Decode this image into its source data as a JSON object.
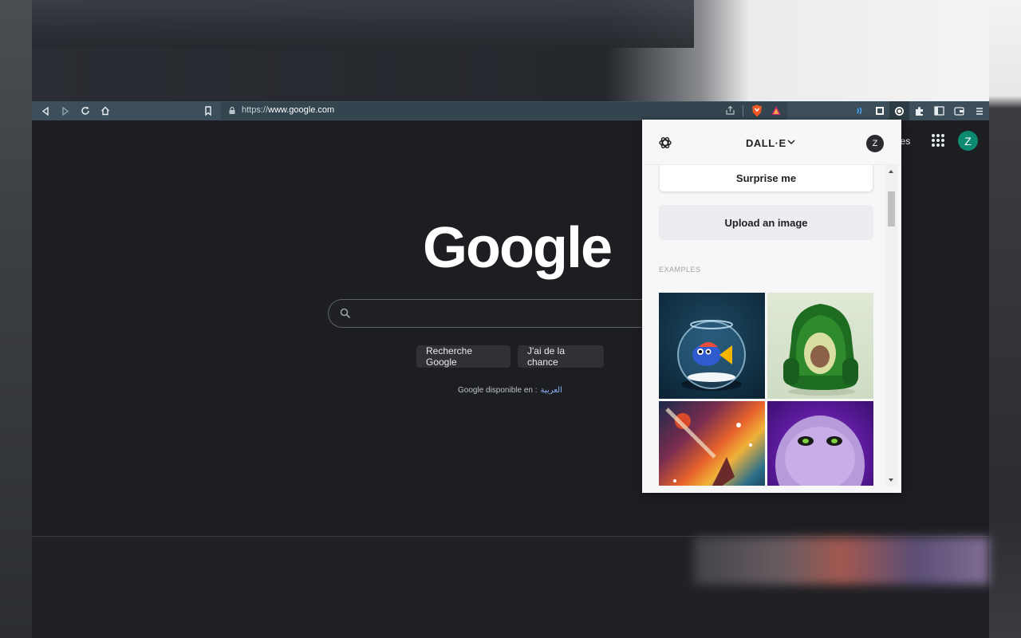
{
  "toolbar": {
    "url_prefix": "https://",
    "url_domain": "www.google.com"
  },
  "google": {
    "logo": "Google",
    "search_button": "Recherche Google",
    "lucky_button": "J'ai de la chance",
    "available_in": "Google disponible en :",
    "language_link": "العربية",
    "images_link": "ges",
    "avatar_letter": "Z"
  },
  "dalle_popup": {
    "title": "DALL·E",
    "avatar_letter": "Z",
    "surprise_button": "Surprise me",
    "upload_button": "Upload an image",
    "examples_label": "EXAMPLES"
  },
  "colors": {
    "toolbar": "#3c4f5a",
    "page_bg": "#1d1e22",
    "google_avatar": "#0f8a72"
  },
  "icons": [
    "back-icon",
    "forward-icon",
    "reload-icon",
    "home-icon",
    "bookmark-icon",
    "lock-icon",
    "share-icon",
    "brave-shield-icon",
    "brave-rewards-icon",
    "wallet-icon",
    "extensions-icon",
    "sidebar-icon",
    "menu-icon",
    "openai-icon",
    "search-icon",
    "apps-grid-icon"
  ]
}
